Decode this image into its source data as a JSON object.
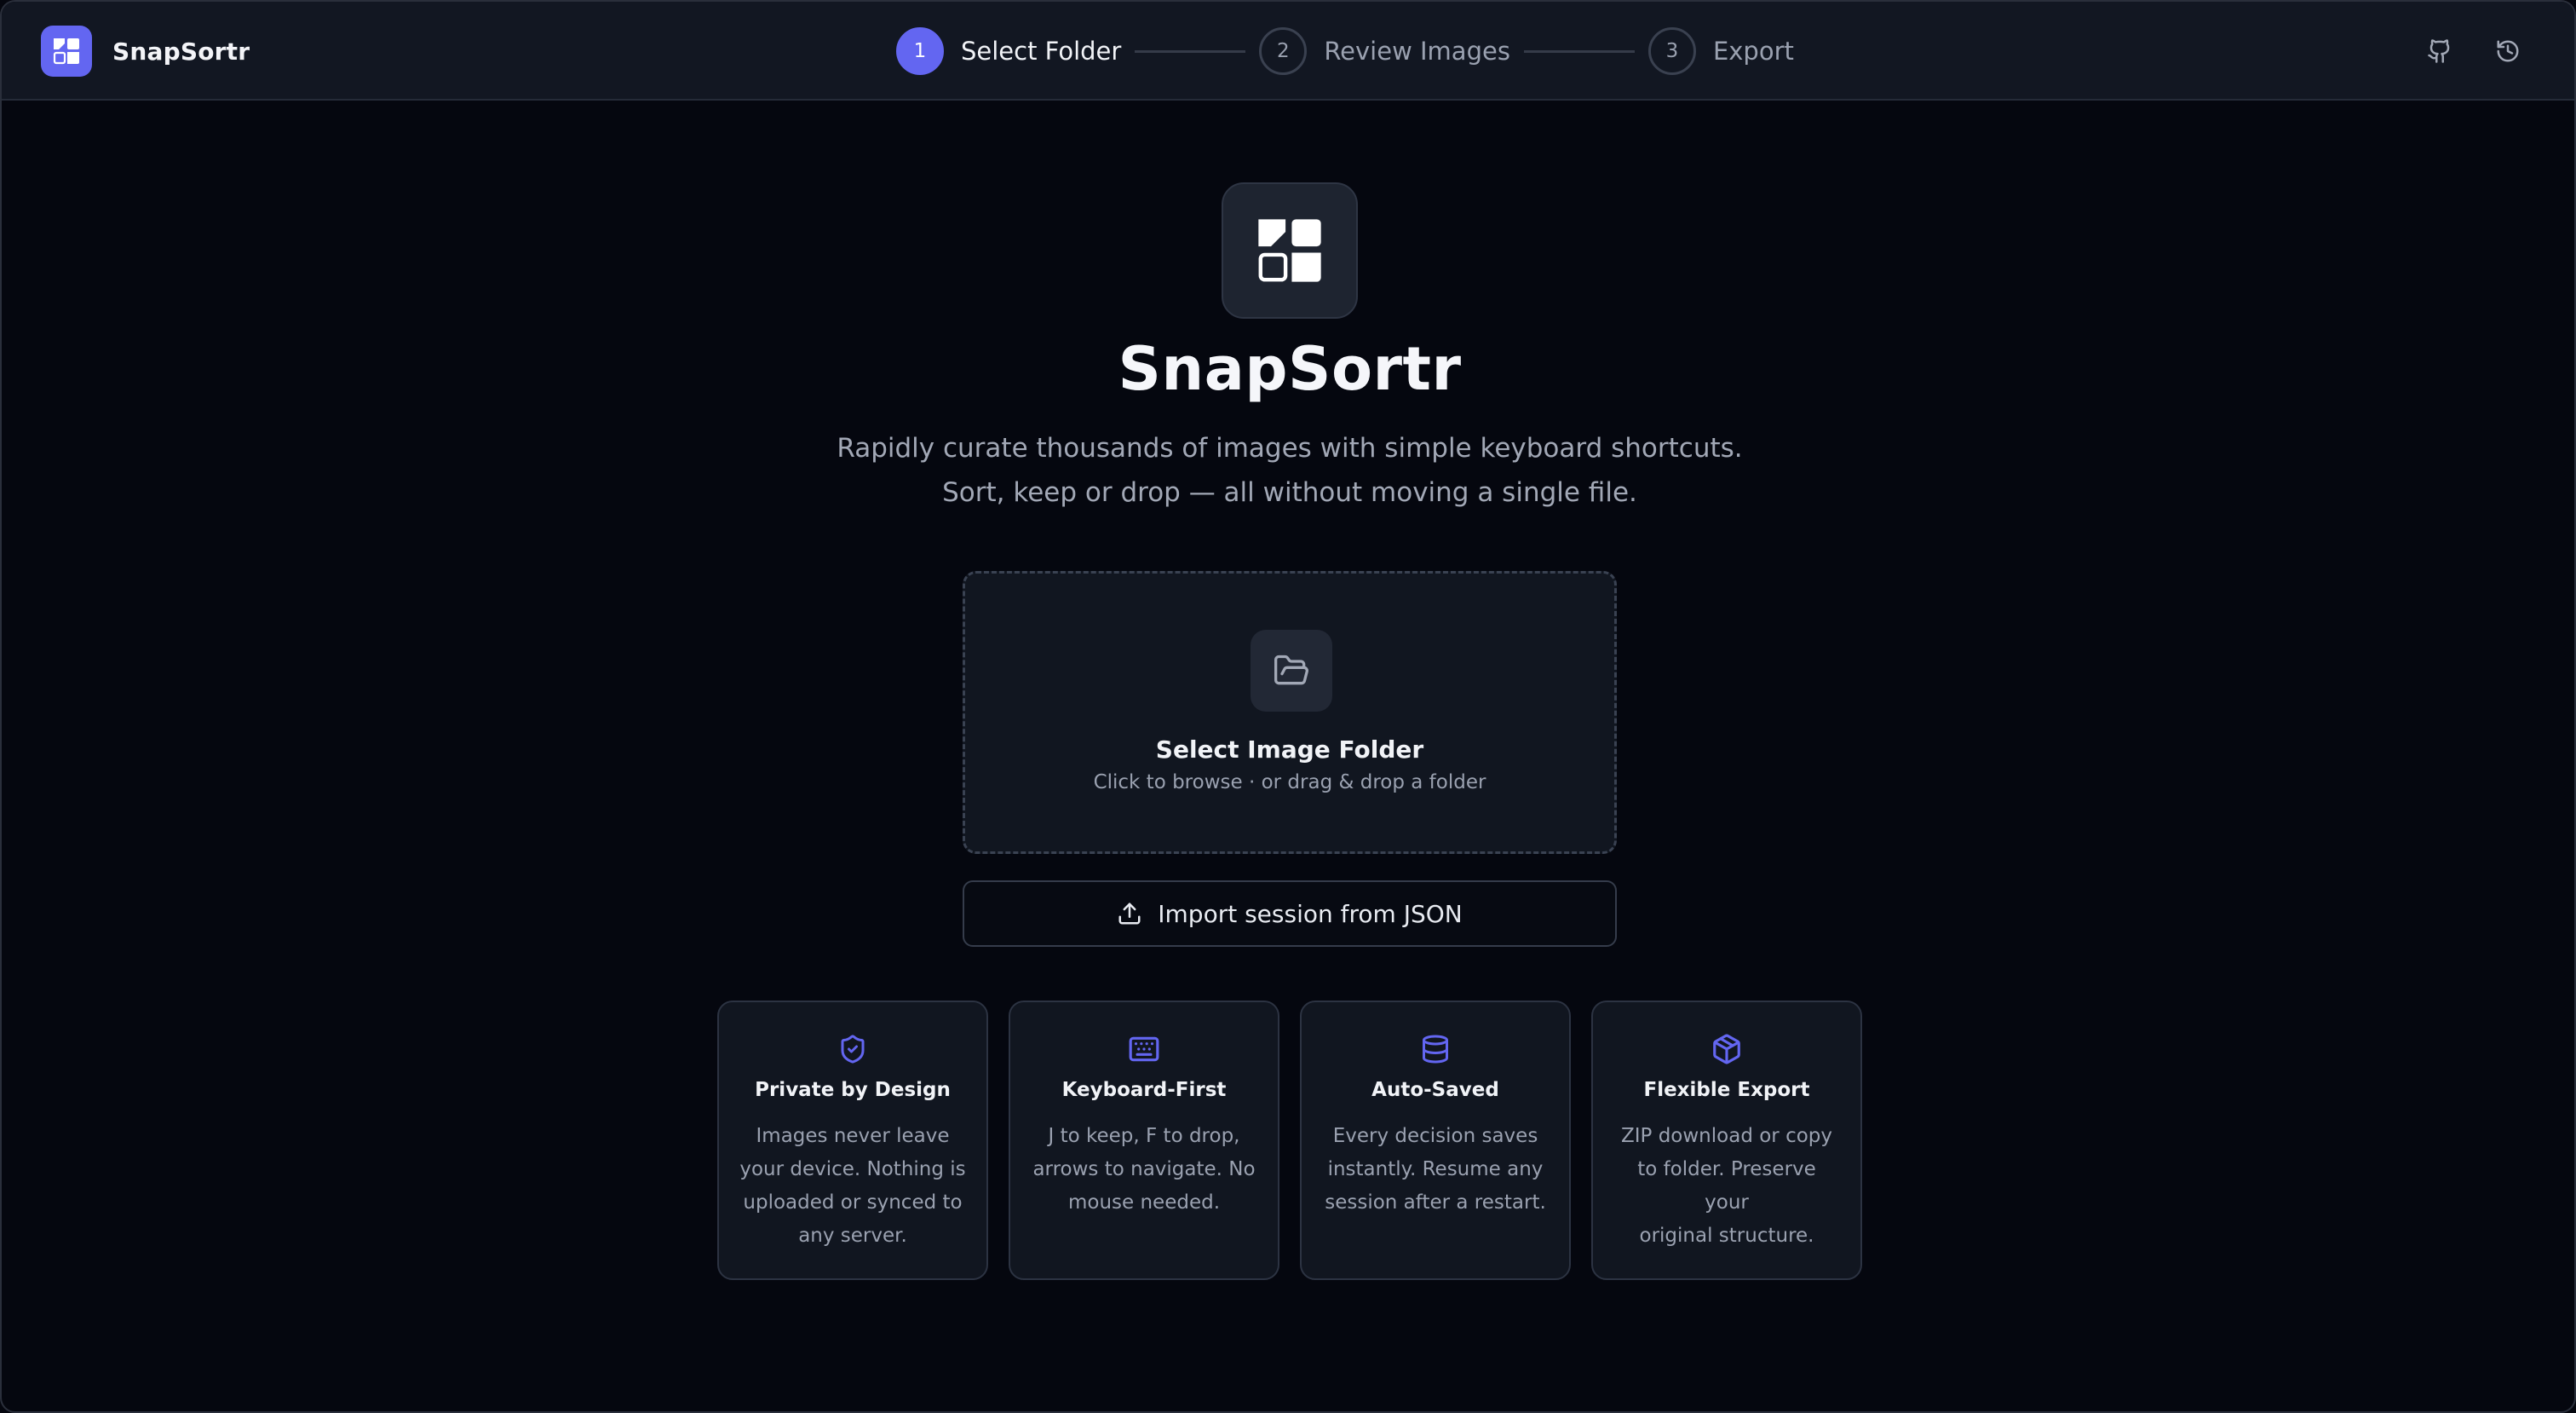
{
  "app": {
    "name": "SnapSortr"
  },
  "stepper": {
    "steps": [
      {
        "number": "1",
        "label": "Select Folder",
        "active": true
      },
      {
        "number": "2",
        "label": "Review Images",
        "active": false
      },
      {
        "number": "3",
        "label": "Export",
        "active": false
      }
    ]
  },
  "header_actions": {
    "icons": [
      "github-icon",
      "history-icon"
    ]
  },
  "hero": {
    "title": "SnapSortr",
    "subtitle_line1": "Rapidly curate thousands of images with simple keyboard shortcuts.",
    "subtitle_line2": "Sort, keep or drop — all without moving a single file."
  },
  "dropzone": {
    "title": "Select Image Folder",
    "subtitle": "Click to browse · or drag & drop a folder",
    "icon": "folder-open-icon"
  },
  "import_button": {
    "label": "Import session from JSON",
    "icon": "upload-icon"
  },
  "features": [
    {
      "icon": "shield-check-icon",
      "title": "Private by Design",
      "desc": [
        "Images never leave",
        "your device. Nothing is",
        "uploaded or synced to",
        "any server."
      ]
    },
    {
      "icon": "keyboard-icon",
      "title": "Keyboard-First",
      "desc": [
        "J to keep, F to drop,",
        "arrows to navigate. No",
        "mouse needed."
      ]
    },
    {
      "icon": "database-icon",
      "title": "Auto-Saved",
      "desc": [
        "Every decision saves",
        "instantly. Resume any",
        "session after a restart."
      ]
    },
    {
      "icon": "package-icon",
      "title": "Flexible Export",
      "desc": [
        "ZIP download or copy",
        "to folder. Preserve your",
        "original structure."
      ]
    }
  ],
  "colors": {
    "accent": "#6366f1",
    "background": "#05070f",
    "surface": "#111620",
    "header": "#121722"
  }
}
